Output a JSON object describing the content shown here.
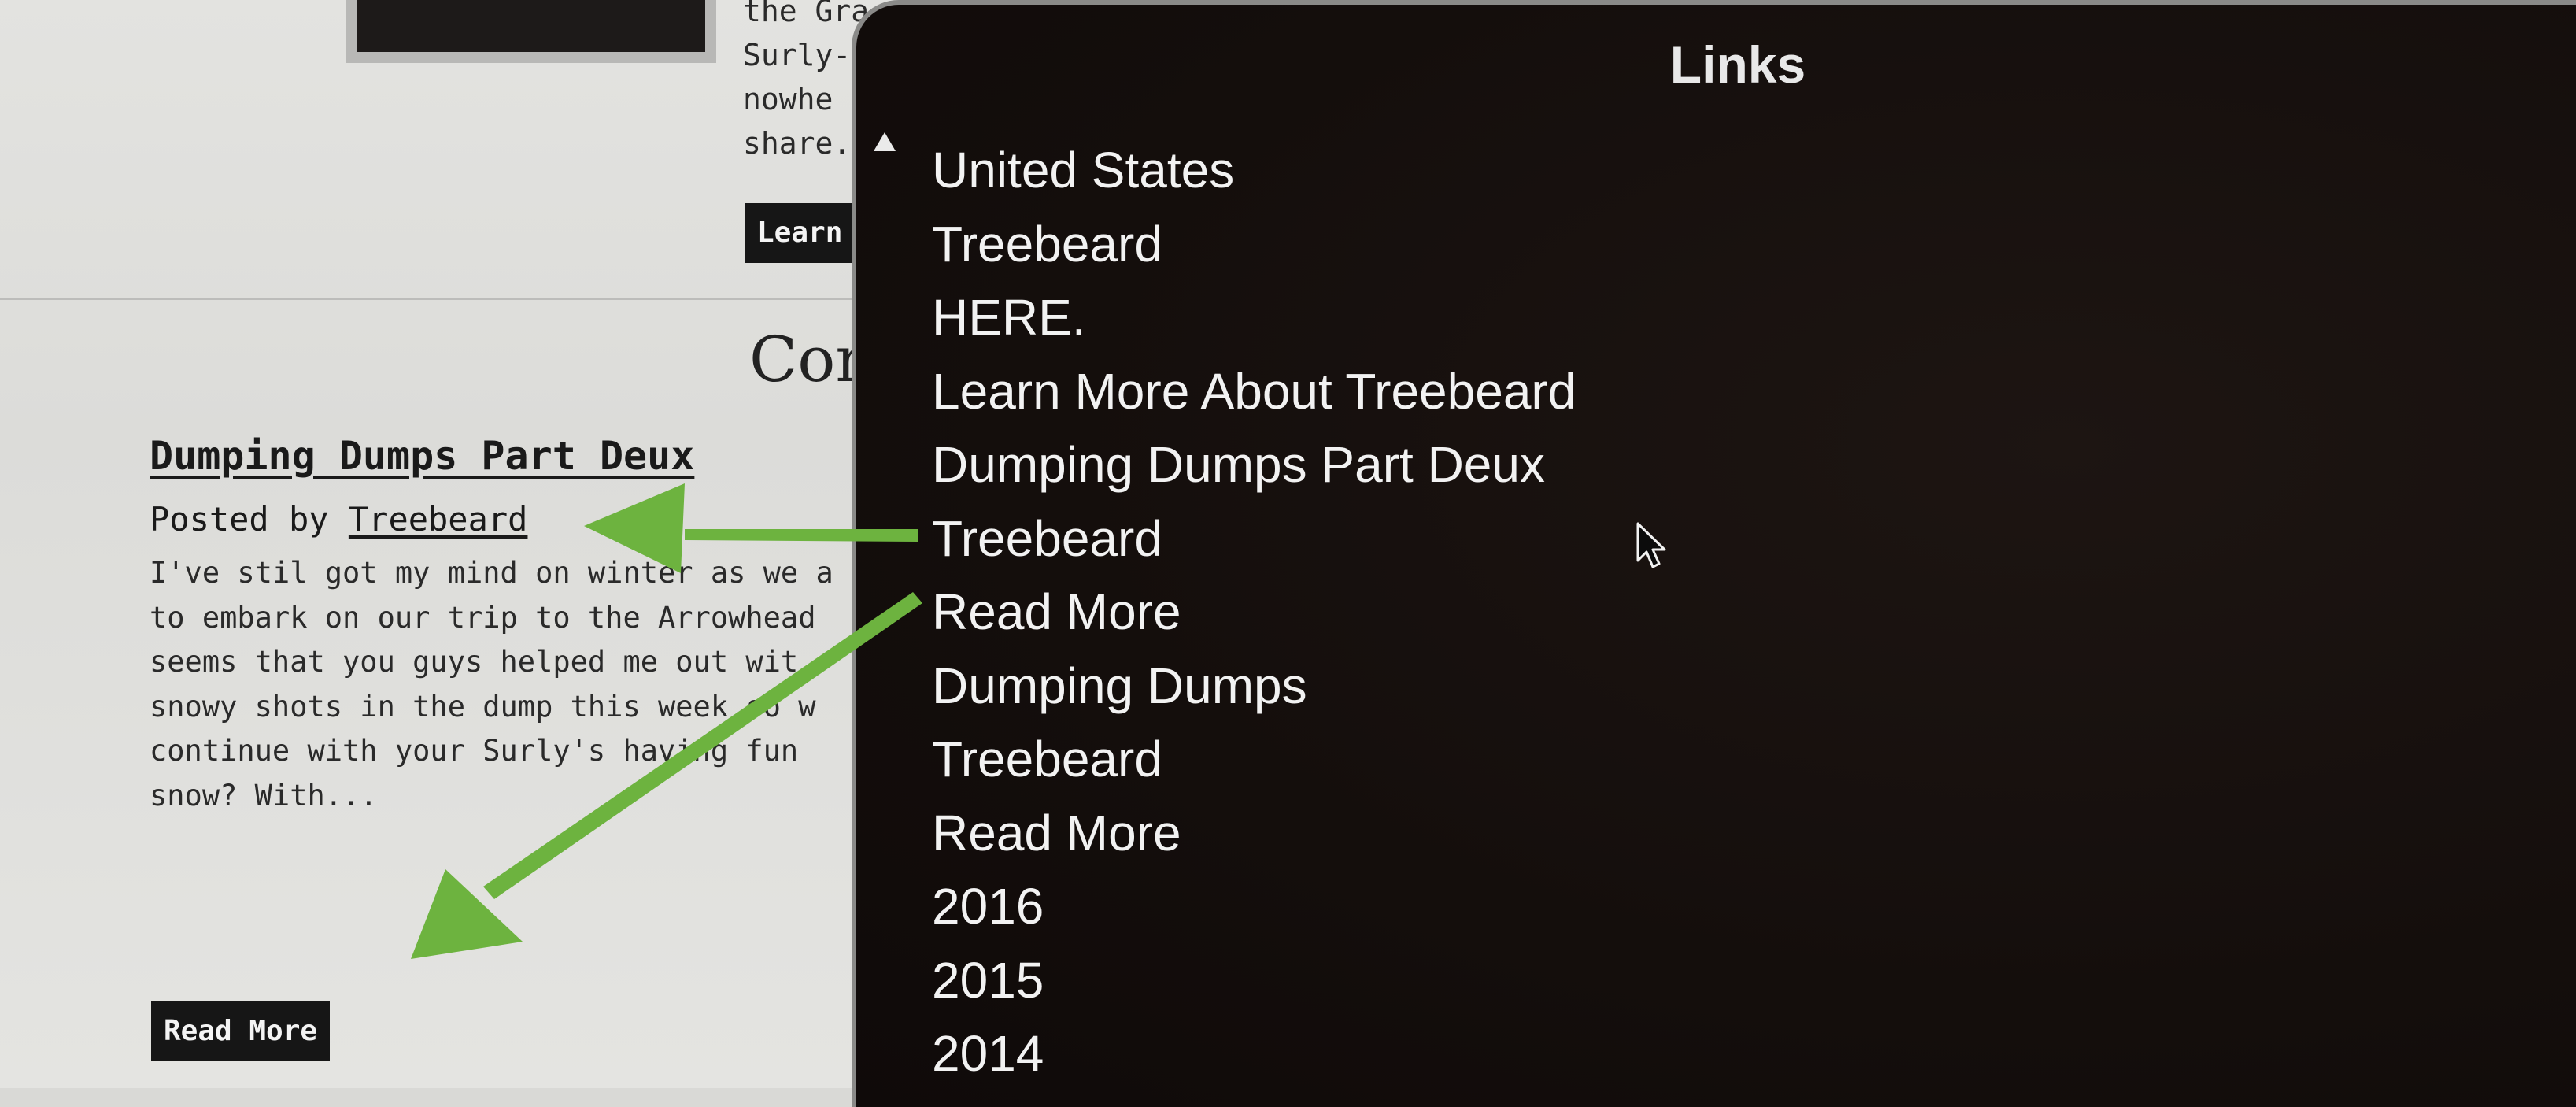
{
  "page": {
    "snippet_lines": [
      "the Gra",
      "Surly-",
      "nowhe",
      "share."
    ],
    "learn_button": "Learn More About Treebeard",
    "section_heading": "Cor",
    "post": {
      "title": "Dumping Dumps Part Deux",
      "posted_by_prefix": "Posted by ",
      "author": "Treebeard",
      "excerpt_lines": [
        "I've stil got my mind on winter as we a",
        "to embark on our trip to the Arrowhead",
        "seems that you guys helped me out wit",
        "snowy shots in the dump this week so w",
        "continue with your Surly's having fun",
        "snow? With..."
      ],
      "read_more": "Read More"
    }
  },
  "links_panel": {
    "title": "Links",
    "items": [
      "United States",
      "Treebeard",
      "HERE.",
      "Learn More About Treebeard",
      "Dumping Dumps Part Deux",
      "Treebeard",
      "Read More",
      "Dumping Dumps",
      "Treebeard",
      "Read More",
      "2016",
      "2015",
      "2014"
    ]
  },
  "colors": {
    "arrow": "#6db33f",
    "panel_bg": "#140e0c",
    "button_bg": "#161616"
  }
}
